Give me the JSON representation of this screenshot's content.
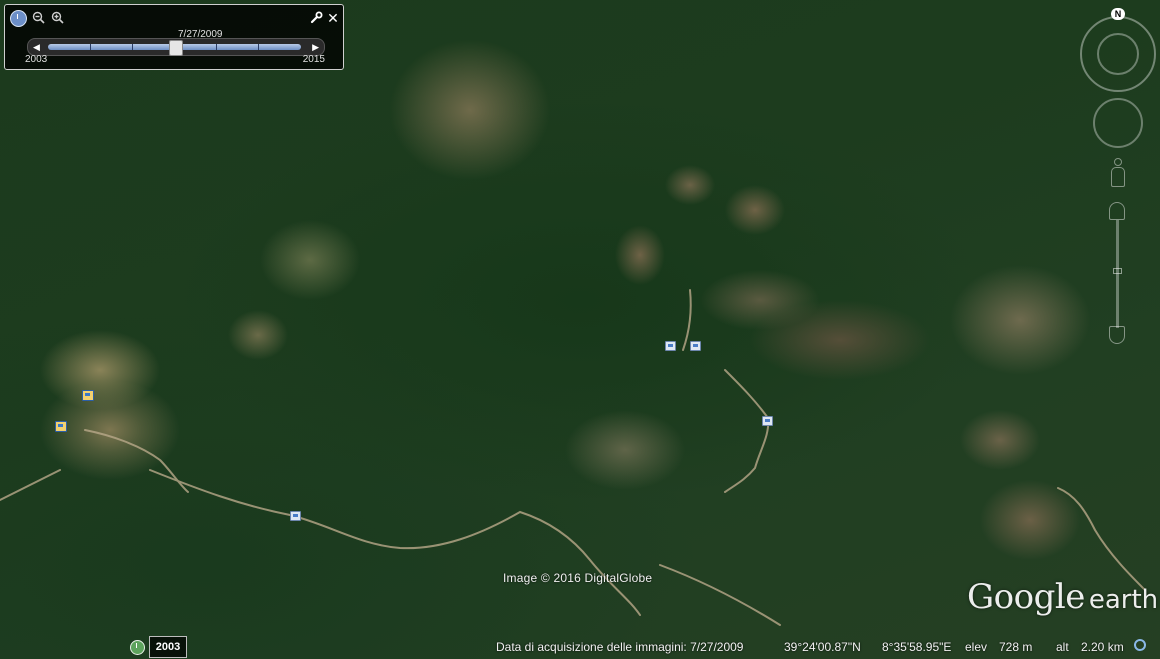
{
  "time_slider": {
    "current_date": "7/27/2009",
    "start_year": "2003",
    "end_year": "2015",
    "position_fraction": 0.5,
    "icons": {
      "clock": "historical-imagery-clock-icon",
      "zoom_out": "zoom-out-icon",
      "zoom_in": "zoom-in-icon",
      "settings": "wrench-icon",
      "close": "close-icon",
      "step_back": "skip-back-icon",
      "step_forward": "skip-forward-icon"
    }
  },
  "navigation": {
    "north_label": "N"
  },
  "map": {
    "attribution": "Image © 2016 DigitalGlobe"
  },
  "logo": {
    "google": "Google",
    "earth": "earth"
  },
  "status_bar": {
    "year_button": "2003",
    "acquisition": "Data di acquisizione delle immagini: 7/27/2009",
    "latitude": "39°24'00.87\"N",
    "longitude": "8°35'58.95\"E",
    "elev_label": "elev",
    "elev_value": "728 m",
    "alt_label": "alt",
    "alt_value": "2.20 km"
  },
  "colors": {
    "slider_track": "#6e8fc4",
    "forest": "#1f3a1c",
    "clearing": "#8a8358"
  }
}
